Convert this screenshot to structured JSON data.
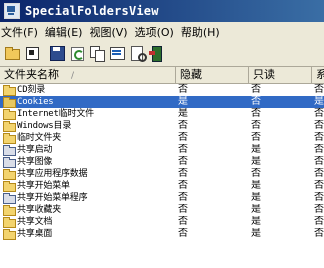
{
  "window": {
    "title": "SpecialFoldersView"
  },
  "menu": [
    "文件(F)",
    "编辑(E)",
    "视图(V)",
    "选项(O)",
    "帮助(H)"
  ],
  "toolbar": {
    "buttons": [
      {
        "name": "open-folder-button",
        "icon": "open-folder-icon"
      },
      {
        "name": "properties-button",
        "icon": "properties-icon"
      },
      {
        "name": "save-button",
        "icon": "save-icon"
      },
      {
        "name": "refresh-button",
        "icon": "refresh-icon"
      },
      {
        "name": "copy-button",
        "icon": "copy-icon"
      },
      {
        "name": "html-report-button",
        "icon": "html-report-icon"
      },
      {
        "name": "find-button",
        "icon": "find-icon"
      },
      {
        "name": "exit-button",
        "icon": "exit-icon"
      }
    ]
  },
  "table": {
    "columns": [
      "文件夹名称",
      "隐藏",
      "只读",
      "系"
    ],
    "sort_indicator": "/",
    "selected_row": 1,
    "rows": [
      {
        "name": "CD刻录",
        "hidden": "否",
        "readonly": "否",
        "system": "否"
      },
      {
        "name": "Cookies",
        "hidden": "是",
        "readonly": "否",
        "system": "是"
      },
      {
        "name": "Internet临时文件",
        "hidden": "是",
        "readonly": "否",
        "system": "否"
      },
      {
        "name": "Windows目录",
        "hidden": "否",
        "readonly": "否",
        "system": "否"
      },
      {
        "name": "临时文件夹",
        "hidden": "否",
        "readonly": "否",
        "system": "否"
      },
      {
        "name": "共享启动",
        "hidden": "否",
        "readonly": "是",
        "system": "否"
      },
      {
        "name": "共享图像",
        "hidden": "否",
        "readonly": "是",
        "system": "否"
      },
      {
        "name": "共享应用程序数据",
        "hidden": "否",
        "readonly": "否",
        "system": "否"
      },
      {
        "name": "共享开始菜单",
        "hidden": "否",
        "readonly": "是",
        "system": "否"
      },
      {
        "name": "共享开始菜单程序",
        "hidden": "否",
        "readonly": "是",
        "system": "否"
      },
      {
        "name": "共享收藏夹",
        "hidden": "否",
        "readonly": "是",
        "system": "否"
      },
      {
        "name": "共享文档",
        "hidden": "否",
        "readonly": "是",
        "system": "否"
      },
      {
        "name": "共享桌面",
        "hidden": "否",
        "readonly": "是",
        "system": "否"
      }
    ]
  }
}
